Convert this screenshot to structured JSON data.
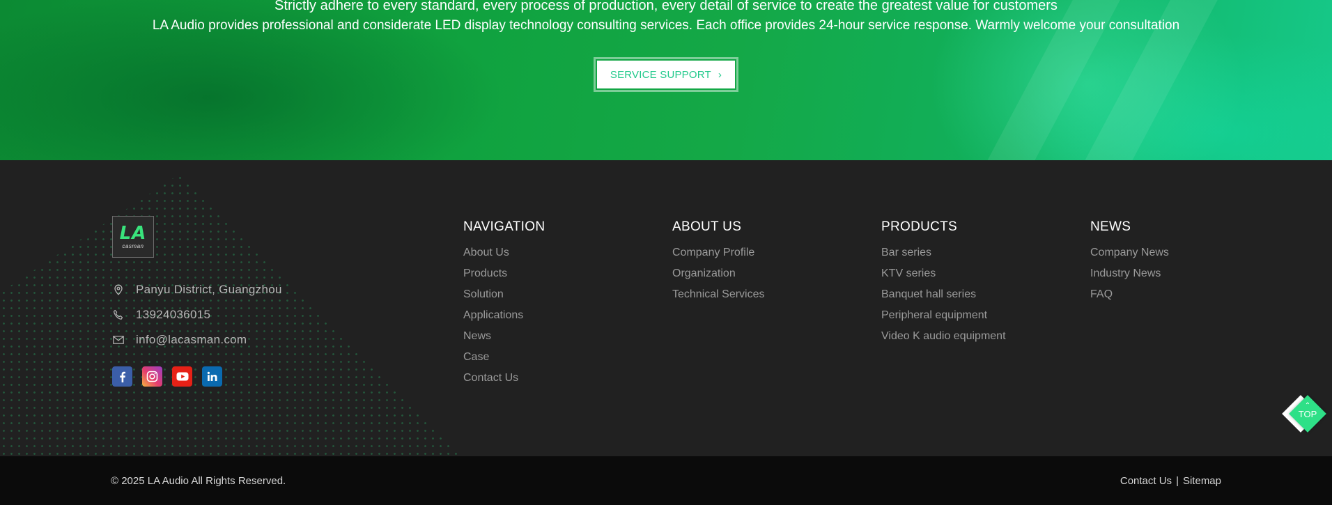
{
  "hero": {
    "line1": "Strictly adhere to every standard, every process of production, every detail of service to create the greatest value for customers",
    "line2": "LA Audio provides professional and considerate LED display technology consulting services. Each office provides 24-hour service response. Warmly welcome your consultation",
    "button_label": "SERVICE SUPPORT",
    "button_icon": "chevron-right-icon"
  },
  "logo": {
    "mark": "LA",
    "wordmark": "casman"
  },
  "contact": {
    "address": "Panyu District, Guangzhou",
    "phone": "13924036015",
    "email": "info@lacasman.com",
    "icons": [
      "location-pin-icon",
      "phone-icon",
      "mail-icon"
    ]
  },
  "socials": [
    "facebook-icon",
    "instagram-icon",
    "youtube-icon",
    "linkedin-icon"
  ],
  "columns": [
    {
      "title": "NAVIGATION",
      "items": [
        "About Us",
        "Products",
        "Solution",
        "Applications",
        "News",
        "Case",
        "Contact Us"
      ]
    },
    {
      "title": "ABOUT US",
      "items": [
        "Company Profile",
        "Organization",
        "Technical Services"
      ]
    },
    {
      "title": "PRODUCTS",
      "items": [
        "Bar series",
        "KTV series",
        "Banquet hall series",
        "Peripheral equipment",
        "Video K audio equipment"
      ]
    },
    {
      "title": "NEWS",
      "items": [
        "Company News",
        "Industry News",
        "FAQ"
      ]
    }
  ],
  "bottom": {
    "copyright": "© 2025 LA Audio All Rights Reserved.",
    "links": [
      "Contact Us",
      "Sitemap"
    ],
    "separator": "|"
  },
  "top_button": {
    "label": "TOP",
    "arrow": "⌃"
  },
  "colors": {
    "accent_green": "#2ee087",
    "footer_bg": "#212121",
    "bottom_bg": "#0b0b0b",
    "button_text": "#1fc98a"
  }
}
